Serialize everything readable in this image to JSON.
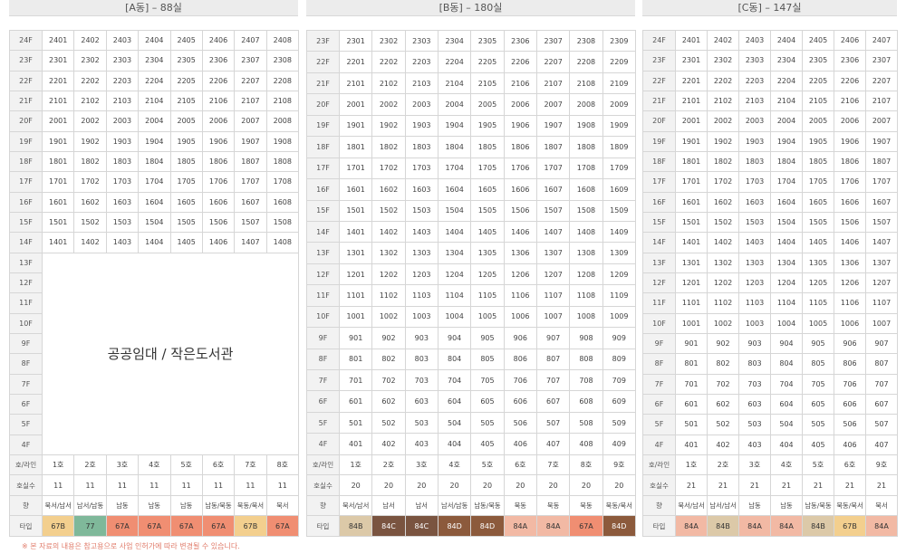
{
  "buildings": [
    {
      "id": "a",
      "title": "[A동] – 88실",
      "lines": 8,
      "top_floor": 24,
      "bottom_floor": 4,
      "residential_low_floor": 14,
      "public_label": "공공임대 / 작은도서관",
      "ho_label": "호/라인",
      "ho": [
        "1호",
        "2호",
        "3호",
        "4호",
        "5호",
        "6호",
        "7호",
        "8호"
      ],
      "count_label": "호실수",
      "counts": [
        "11",
        "11",
        "11",
        "11",
        "11",
        "11",
        "11",
        "11"
      ],
      "dir_label": "향",
      "dirs": [
        "북서/남서",
        "남서/남동",
        "남동",
        "남동",
        "남동",
        "남동/북동",
        "북동/북서",
        "북서"
      ],
      "type_label": "타입",
      "types": [
        "67B",
        "77",
        "67A",
        "67A",
        "67A",
        "67A",
        "67B",
        "67A"
      ],
      "type_colors": [
        "#f3cf8e",
        "#7fb89a",
        "#f08e72",
        "#f08e72",
        "#f08e72",
        "#f08e72",
        "#f3cf8e",
        "#f08e72"
      ]
    },
    {
      "id": "b",
      "title": "[B동] – 180실",
      "lines": 9,
      "top_floor": 23,
      "bottom_floor": 4,
      "ho_label": "호/라인",
      "ho": [
        "1호",
        "2호",
        "3호",
        "4호",
        "5호",
        "6호",
        "7호",
        "8호",
        "9호"
      ],
      "count_label": "호실수",
      "counts": [
        "20",
        "20",
        "20",
        "20",
        "20",
        "20",
        "20",
        "20",
        "20"
      ],
      "dir_label": "향",
      "dirs": [
        "북서/남서",
        "남서",
        "남서",
        "남서/남동",
        "남동/북동",
        "북동",
        "북동",
        "북동",
        "북동/북서"
      ],
      "type_label": "타입",
      "types": [
        "84B",
        "84C",
        "84C",
        "84D",
        "84D",
        "84A",
        "84A",
        "67A",
        "84D"
      ],
      "type_colors": [
        "#dcc9a8",
        "#7a5440",
        "#7a5440",
        "#8c5a3c",
        "#8c5a3c",
        "#f2b9a4",
        "#f2b9a4",
        "#f08e72",
        "#8c5a3c"
      ]
    },
    {
      "id": "c",
      "title": "[C동] – 147실",
      "lines": 7,
      "top_floor": 24,
      "bottom_floor": 4,
      "ho_label": "호/라인",
      "ho": [
        "1호",
        "2호",
        "3호",
        "4호",
        "5호",
        "6호",
        "9호"
      ],
      "count_label": "호실수",
      "counts": [
        "21",
        "21",
        "21",
        "21",
        "21",
        "21",
        "21"
      ],
      "dir_label": "향",
      "dirs": [
        "북서/남서",
        "남서/남서",
        "남동",
        "남동",
        "남동/북동",
        "북동/북서",
        "북서"
      ],
      "type_label": "타입",
      "types": [
        "84A",
        "84B",
        "84A",
        "84A",
        "84B",
        "67B",
        "84A"
      ],
      "type_colors": [
        "#f2b9a4",
        "#dcc9a8",
        "#f2b9a4",
        "#f2b9a4",
        "#dcc9a8",
        "#f3cf8e",
        "#f2b9a4"
      ]
    }
  ],
  "note": "※ 본 자료의 내용은 참고용으로 사업 인허가에 따라 변경될 수 있습니다."
}
